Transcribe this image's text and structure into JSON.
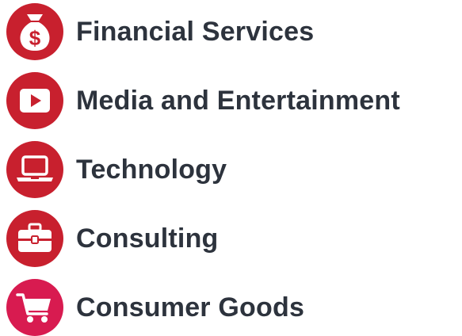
{
  "colors": {
    "icon_red": "#c8202e",
    "icon_pink": "#d81b50",
    "text": "#2d333d",
    "icon_glyph": "#ffffff"
  },
  "industries": [
    {
      "label": "Financial Services",
      "icon": "money-bag-icon"
    },
    {
      "label": "Media and Entertainment",
      "icon": "play-button-icon"
    },
    {
      "label": "Technology",
      "icon": "laptop-icon"
    },
    {
      "label": "Consulting",
      "icon": "briefcase-icon"
    },
    {
      "label": "Consumer Goods",
      "icon": "shopping-cart-icon"
    }
  ]
}
